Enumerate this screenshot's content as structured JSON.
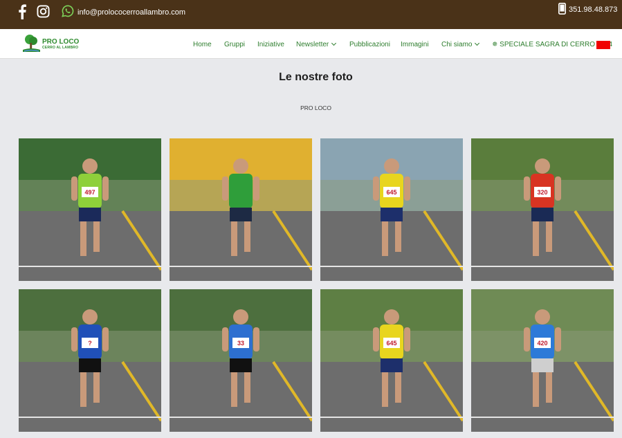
{
  "topbar": {
    "email": "info@prolococerroallambro.com",
    "phone": "351.98.48.873",
    "icons": [
      "facebook-icon",
      "instagram-icon",
      "whatsapp-icon",
      "phone-icon"
    ]
  },
  "brand": {
    "name_line1": "PRO LOCO",
    "name_line2": "CERRO AL LAMBRO"
  },
  "nav": {
    "items": [
      {
        "label": "Home"
      },
      {
        "label": "Gruppi"
      },
      {
        "label": "Iniziative"
      },
      {
        "label": "Newsletter"
      },
      {
        "label": "Pubblicazioni"
      },
      {
        "label": "Immagini"
      },
      {
        "label": "Chi siamo"
      },
      {
        "label": "✵ SPECIALE SAGRA DI CERRO 2024"
      }
    ]
  },
  "page": {
    "title": "Le nostre foto",
    "subtitle": "PRO LOCO"
  },
  "gallery": {
    "photos": [
      {
        "bib": "497",
        "shirt": "#8ed03a",
        "shorts": "#1b2a5a",
        "bg": "#3b6b35"
      },
      {
        "bib": "",
        "shirt": "#2f9e3a",
        "shorts": "#1d2a44",
        "bg": "#e0b030"
      },
      {
        "bib": "645",
        "shirt": "#e8d51e",
        "shorts": "#1d2f6b",
        "bg": "#8aa4b2"
      },
      {
        "bib": "320",
        "shirt": "#d83422",
        "shorts": "#1a2a55",
        "bg": "#5a7d3c"
      },
      {
        "bib": "?",
        "shirt": "#2050b8",
        "shorts": "#111111",
        "bg": "#4d6f3e"
      },
      {
        "bib": "33",
        "shirt": "#2d6fd0",
        "shorts": "#111111",
        "bg": "#4d6f3e"
      },
      {
        "bib": "645",
        "shirt": "#e8d51e",
        "shorts": "#1d2f6b",
        "bg": "#5e7f44"
      },
      {
        "bib": "420",
        "shirt": "#2d7ad8",
        "shorts": "#cfcfcf",
        "bg": "#6f8b55"
      }
    ]
  },
  "colors": {
    "topbar_bg": "#4a3218",
    "nav_text": "#2d7d2d",
    "page_bg": "#e8e9ec",
    "flag": "#f00000"
  }
}
